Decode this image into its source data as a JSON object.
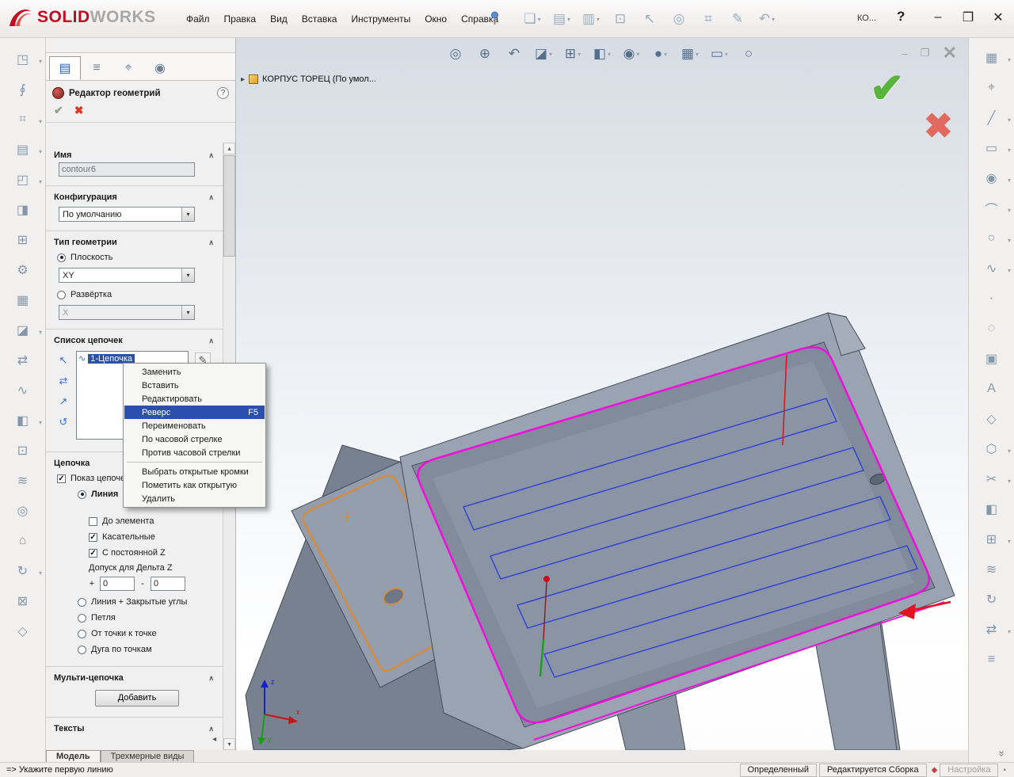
{
  "icons": {
    "dropdown": "▾",
    "collapse": "∧",
    "scroll_up": "▴",
    "scroll_down": "▾",
    "tab_nav": "◂ ▸",
    "breadcrumb_arrow": "▸",
    "ok": "✔",
    "cancel": "✖",
    "confirm_ok": "✔",
    "confirm_cancel": "✖",
    "doc_min": "–",
    "doc_restore": "❐",
    "doc_close": "✕",
    "win_min": "–",
    "win_restore": "❐",
    "win_close": "✕",
    "edit_pencil": "✎",
    "more": "»",
    "list_item_icon": "∿",
    "status_flag": "◆",
    "status_dot": "▪"
  },
  "titlebar": {
    "logo": {
      "solid": "SOLID",
      "works": "WORKS"
    },
    "menus": [
      {
        "label": "Файл",
        "name": "menu-file"
      },
      {
        "label": "Правка",
        "name": "menu-edit"
      },
      {
        "label": "Вид",
        "name": "menu-view"
      },
      {
        "label": "Вставка",
        "name": "menu-insert"
      },
      {
        "label": "Инструменты",
        "name": "menu-tools"
      },
      {
        "label": "Окно",
        "name": "menu-window"
      },
      {
        "label": "Справка",
        "name": "menu-help"
      }
    ],
    "tools": [
      {
        "name": "new-document-button",
        "glyph": "❏",
        "arrow": true
      },
      {
        "name": "open-document-button",
        "glyph": "▤",
        "arrow": true
      },
      {
        "name": "save-button",
        "glyph": "▥",
        "arrow": true
      },
      {
        "name": "print-button",
        "glyph": "⊡"
      },
      {
        "name": "select-button",
        "glyph": "↖"
      },
      {
        "name": "zoom-button",
        "glyph": "◎"
      },
      {
        "name": "measure-button",
        "glyph": "⌗"
      },
      {
        "name": "sketch-button",
        "glyph": "✎"
      },
      {
        "name": "undo-button",
        "glyph": "↶",
        "arrow": true
      }
    ],
    "overflow": "КО...",
    "help": "?"
  },
  "left_toolbar": {
    "tools": [
      {
        "name": "open-setup-icon",
        "glyph": "◳",
        "arrow": true
      },
      {
        "name": "paperclip-icon",
        "glyph": "∮"
      },
      {
        "name": "copy-geometry-icon",
        "glyph": "⌗",
        "arrow": true
      },
      {
        "name": "part-icon",
        "glyph": "▤",
        "arrow": true
      },
      {
        "name": "box-icon",
        "glyph": "◰",
        "arrow": true
      },
      {
        "name": "edit-sketch-icon",
        "glyph": "◨"
      },
      {
        "name": "extrude-icon",
        "glyph": "⊞"
      },
      {
        "name": "gear-icon",
        "glyph": "⚙"
      },
      {
        "name": "pattern-icon",
        "glyph": "▦"
      },
      {
        "name": "section-icon",
        "glyph": "◪",
        "arrow": true
      },
      {
        "name": "swap-icon",
        "glyph": "⇄"
      },
      {
        "name": "spline-tool-icon",
        "glyph": "∿"
      },
      {
        "name": "half-section-icon",
        "glyph": "◧",
        "arrow": true
      },
      {
        "name": "target-box-icon",
        "glyph": "⊡"
      },
      {
        "name": "waves-icon",
        "glyph": "≋"
      },
      {
        "name": "circle-tool-icon",
        "glyph": "◎"
      },
      {
        "name": "home-icon",
        "glyph": "⌂"
      },
      {
        "name": "rotate-tool-icon",
        "glyph": "↻",
        "arrow": true
      },
      {
        "name": "cross-box-icon",
        "glyph": "⊠"
      },
      {
        "name": "diamond-icon",
        "glyph": "◇"
      }
    ]
  },
  "right_toolbar": {
    "tools": [
      {
        "name": "sketch-icon",
        "glyph": "▦",
        "arrow": true
      },
      {
        "name": "smart-dimension-icon",
        "glyph": "⌖"
      },
      {
        "name": "line-icon",
        "glyph": "╱",
        "arrow": true
      },
      {
        "name": "rectangle-icon",
        "glyph": "▭",
        "arrow": true
      },
      {
        "name": "circle-icon",
        "glyph": "◉",
        "arrow": true
      },
      {
        "name": "arc-icon",
        "glyph": "⌒",
        "arrow": true
      },
      {
        "name": "ellipse-icon",
        "glyph": "○",
        "arrow": true
      },
      {
        "name": "spline-icon",
        "glyph": "∿",
        "arrow": true
      },
      {
        "name": "point-icon",
        "glyph": "∙"
      },
      {
        "name": "construction-circle-icon",
        "glyph": "◌"
      },
      {
        "name": "slot-icon",
        "glyph": "▣"
      },
      {
        "name": "text-icon",
        "glyph": "А"
      },
      {
        "name": "plane-icon",
        "glyph": "◇"
      },
      {
        "name": "polygon-icon",
        "glyph": "⬡",
        "arrow": true
      },
      {
        "name": "trim-scissors-icon",
        "glyph": "✂",
        "arrow": true
      },
      {
        "name": "mirror-icon",
        "glyph": "◧"
      },
      {
        "name": "linear-pattern-icon",
        "glyph": "⊞",
        "arrow": true
      },
      {
        "name": "offset-icon",
        "glyph": "≋"
      },
      {
        "name": "convert-entities-icon",
        "glyph": "↻"
      },
      {
        "name": "move-entities-icon",
        "glyph": "⇄",
        "arrow": true
      },
      {
        "name": "grid-icon",
        "glyph": "≡"
      }
    ]
  },
  "viewport": {
    "tools": [
      {
        "name": "zoom-fit-button",
        "glyph": "◎"
      },
      {
        "name": "zoom-area-button",
        "glyph": "⊕"
      },
      {
        "name": "previous-view-button",
        "glyph": "↶"
      },
      {
        "name": "section-view-button",
        "glyph": "◪",
        "arrow": true
      },
      {
        "name": "view-orientation-button",
        "glyph": "⊞",
        "arrow": true
      },
      {
        "name": "display-style-button",
        "glyph": "◧",
        "arrow": true
      },
      {
        "name": "hide-show-items-button",
        "glyph": "◉",
        "arrow": true
      },
      {
        "name": "edit-appearance-button",
        "glyph": "●",
        "arrow": true
      },
      {
        "name": "apply-scene-button",
        "glyph": "▦",
        "arrow": true
      },
      {
        "name": "view-settings-button",
        "glyph": "▭",
        "arrow": true
      },
      {
        "name": "sphere-button",
        "glyph": "○"
      }
    ],
    "breadcrumb": {
      "label": "КОРПУС ТОРЕЦ  (По умол..."
    }
  },
  "panel": {
    "tabs": [
      {
        "name": "tab-properties",
        "glyph": "▤",
        "active": true
      },
      {
        "name": "tab-configurations",
        "glyph": "≡"
      },
      {
        "name": "tab-dimxpert",
        "glyph": "⌖"
      },
      {
        "name": "tab-appearances",
        "glyph": "◉"
      }
    ],
    "title": "Редактор геометрий",
    "help_glyph": "?",
    "name_section": {
      "label": "Имя",
      "value": "contour6"
    },
    "config_section": {
      "label": "Конфигурация",
      "value": "По умолчанию"
    },
    "geometry_section": {
      "label": "Тип геометрии",
      "plane": {
        "label": "Плоскость",
        "checked": true,
        "value": "XY"
      },
      "unfold": {
        "label": "Развёртка",
        "checked": false,
        "value": "X"
      }
    },
    "chains_section": {
      "label": "Список цепочек",
      "items": [
        {
          "label": "1-Цепочка",
          "selected": true,
          "name": "chain-list-item"
        }
      ],
      "side_icons": [
        {
          "name": "select-chain-icon",
          "glyph": "↖"
        },
        {
          "name": "swap-chain-icon",
          "glyph": "⇄"
        },
        {
          "name": "pick-chain-icon",
          "glyph": "↗"
        },
        {
          "name": "undo-chain-icon",
          "glyph": "↺"
        }
      ]
    },
    "chain_section": {
      "label": "Цепочка",
      "show_chains": {
        "label": "Показ цепочек",
        "checked": true
      },
      "mode_line": {
        "label": "Линия",
        "checked": true
      },
      "to_element": {
        "label": "До элемента",
        "checked": false
      },
      "tangent": {
        "label": "Касательные",
        "checked": true
      },
      "const_z": {
        "label": "С постоянной Z",
        "checked": true
      },
      "tolerance_label": "Допуск для Дельта Z",
      "plus": "+",
      "minus": "-",
      "plus_value": "0",
      "minus_value": "0",
      "mode_line_corners": {
        "label": "Линия + Закрытые углы",
        "checked": false
      },
      "mode_loop": {
        "label": "Петля",
        "checked": false
      },
      "mode_point": {
        "label": "От точки к точке",
        "checked": false
      },
      "mode_arc": {
        "label": "Дуга по точкам",
        "checked": false
      }
    },
    "multichain_section": {
      "label": "Мульти-цепочка",
      "add_button": "Добавить"
    },
    "texts_section": {
      "label": "Тексты"
    },
    "bottom_tabs": [
      {
        "label": "Модель",
        "active": true,
        "name": "tab-model"
      },
      {
        "label": "Трехмерные виды",
        "name": "tab-3d-views"
      }
    ]
  },
  "context_menu": {
    "items": [
      {
        "label": "Заменить",
        "name": "ctx-replace"
      },
      {
        "label": "Вставить",
        "name": "ctx-insert"
      },
      {
        "label": "Редактировать",
        "name": "ctx-edit"
      },
      {
        "label": "Реверс",
        "shortcut": "F5",
        "highlighted": true,
        "name": "ctx-reverse"
      },
      {
        "label": "Переименовать",
        "name": "ctx-rename"
      },
      {
        "label": "По часовой стрелке",
        "name": "ctx-clockwise"
      },
      {
        "label": "Против часовой стрелки",
        "name": "ctx-counterclockwise"
      },
      {
        "separator": true,
        "name": "ctx-separator"
      },
      {
        "label": "Выбрать открытые кромки",
        "name": "ctx-select-open-edges"
      },
      {
        "label": "Пометить как открытую",
        "name": "ctx-mark-open"
      },
      {
        "label": "Удалить",
        "name": "ctx-delete"
      }
    ]
  },
  "statusbar": {
    "message": "=> Укажите первую линию",
    "state": "Определенный",
    "edit_mode": "Редактируется Сборка",
    "settings": "Настройка"
  }
}
